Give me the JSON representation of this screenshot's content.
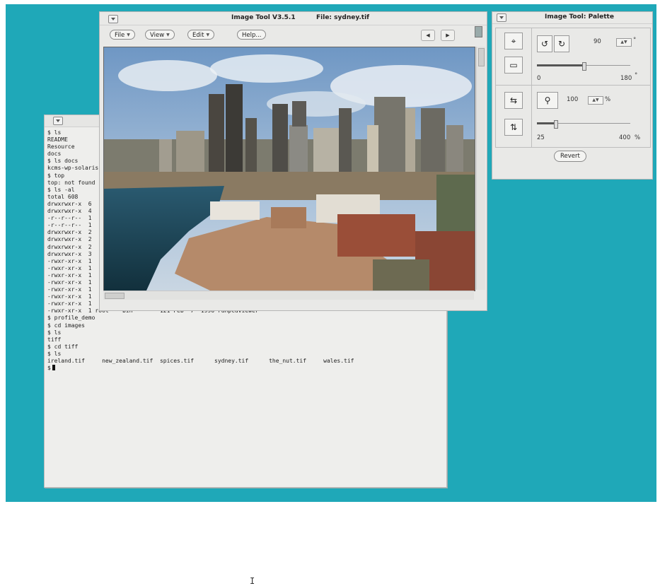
{
  "terminal": {
    "lines": [
      "$ ls",
      "README",
      "Resource",
      "docs",
      "$ ls docs",
      "kcms-wp-solaris",
      "$ top",
      "top: not found",
      "$ ls -al",
      "total 608",
      "drwxrwxr-x  6",
      "drwxrwxr-x  4",
      "-r--r--r--  1",
      "-r--r--r--  1",
      "drwxrwxr-x  2",
      "drwxrwxr-x  2",
      "drwxrwxr-x  2",
      "drwxrwxr-x  3",
      "-rwxr-xr-x  1",
      "-rwxr-xr-x  1",
      "-rwxr-xr-x  1",
      "-rwxr-xr-x  1",
      "-rwxr-xr-x  1",
      "-rwxr-xr-x  1",
      "-rwxr-xr-x  1",
      "-rwxr-xr-x  1 root    bin        121 Feb  7  1996 runpcdviewer",
      "$ profile_demo",
      "$ cd images",
      "$ ls",
      "tiff",
      "$ cd tiff",
      "$ ls",
      "ireland.tif     new_zealand.tif  spices.tif      sydney.tif      the_nut.tif     wales.tif"
    ],
    "prompt": "$"
  },
  "image_tool": {
    "title": "Image Tool V3.5.1",
    "file_label": "File: sydney.tif",
    "menus": [
      "File",
      "View",
      "Edit"
    ],
    "help": "Help...",
    "prev_icon": "left-arrow-icon",
    "next_icon": "right-arrow-icon"
  },
  "palette": {
    "title": "Image Tool: Palette",
    "rotate_value": "90",
    "rotate_unit": "°",
    "rotate_min": "0",
    "rotate_max": "180",
    "rotate_max_unit": "°",
    "rotate_level": 0.5,
    "zoom_value": "100",
    "zoom_unit": "%",
    "zoom_min": "25",
    "zoom_max": "400",
    "zoom_max_unit": "%",
    "zoom_level": 0.2,
    "revert": "Revert"
  },
  "colors": {
    "desktop": "#1fa8b8",
    "window": "#e9e9e7",
    "terminal_bg": "#eeeeec"
  }
}
